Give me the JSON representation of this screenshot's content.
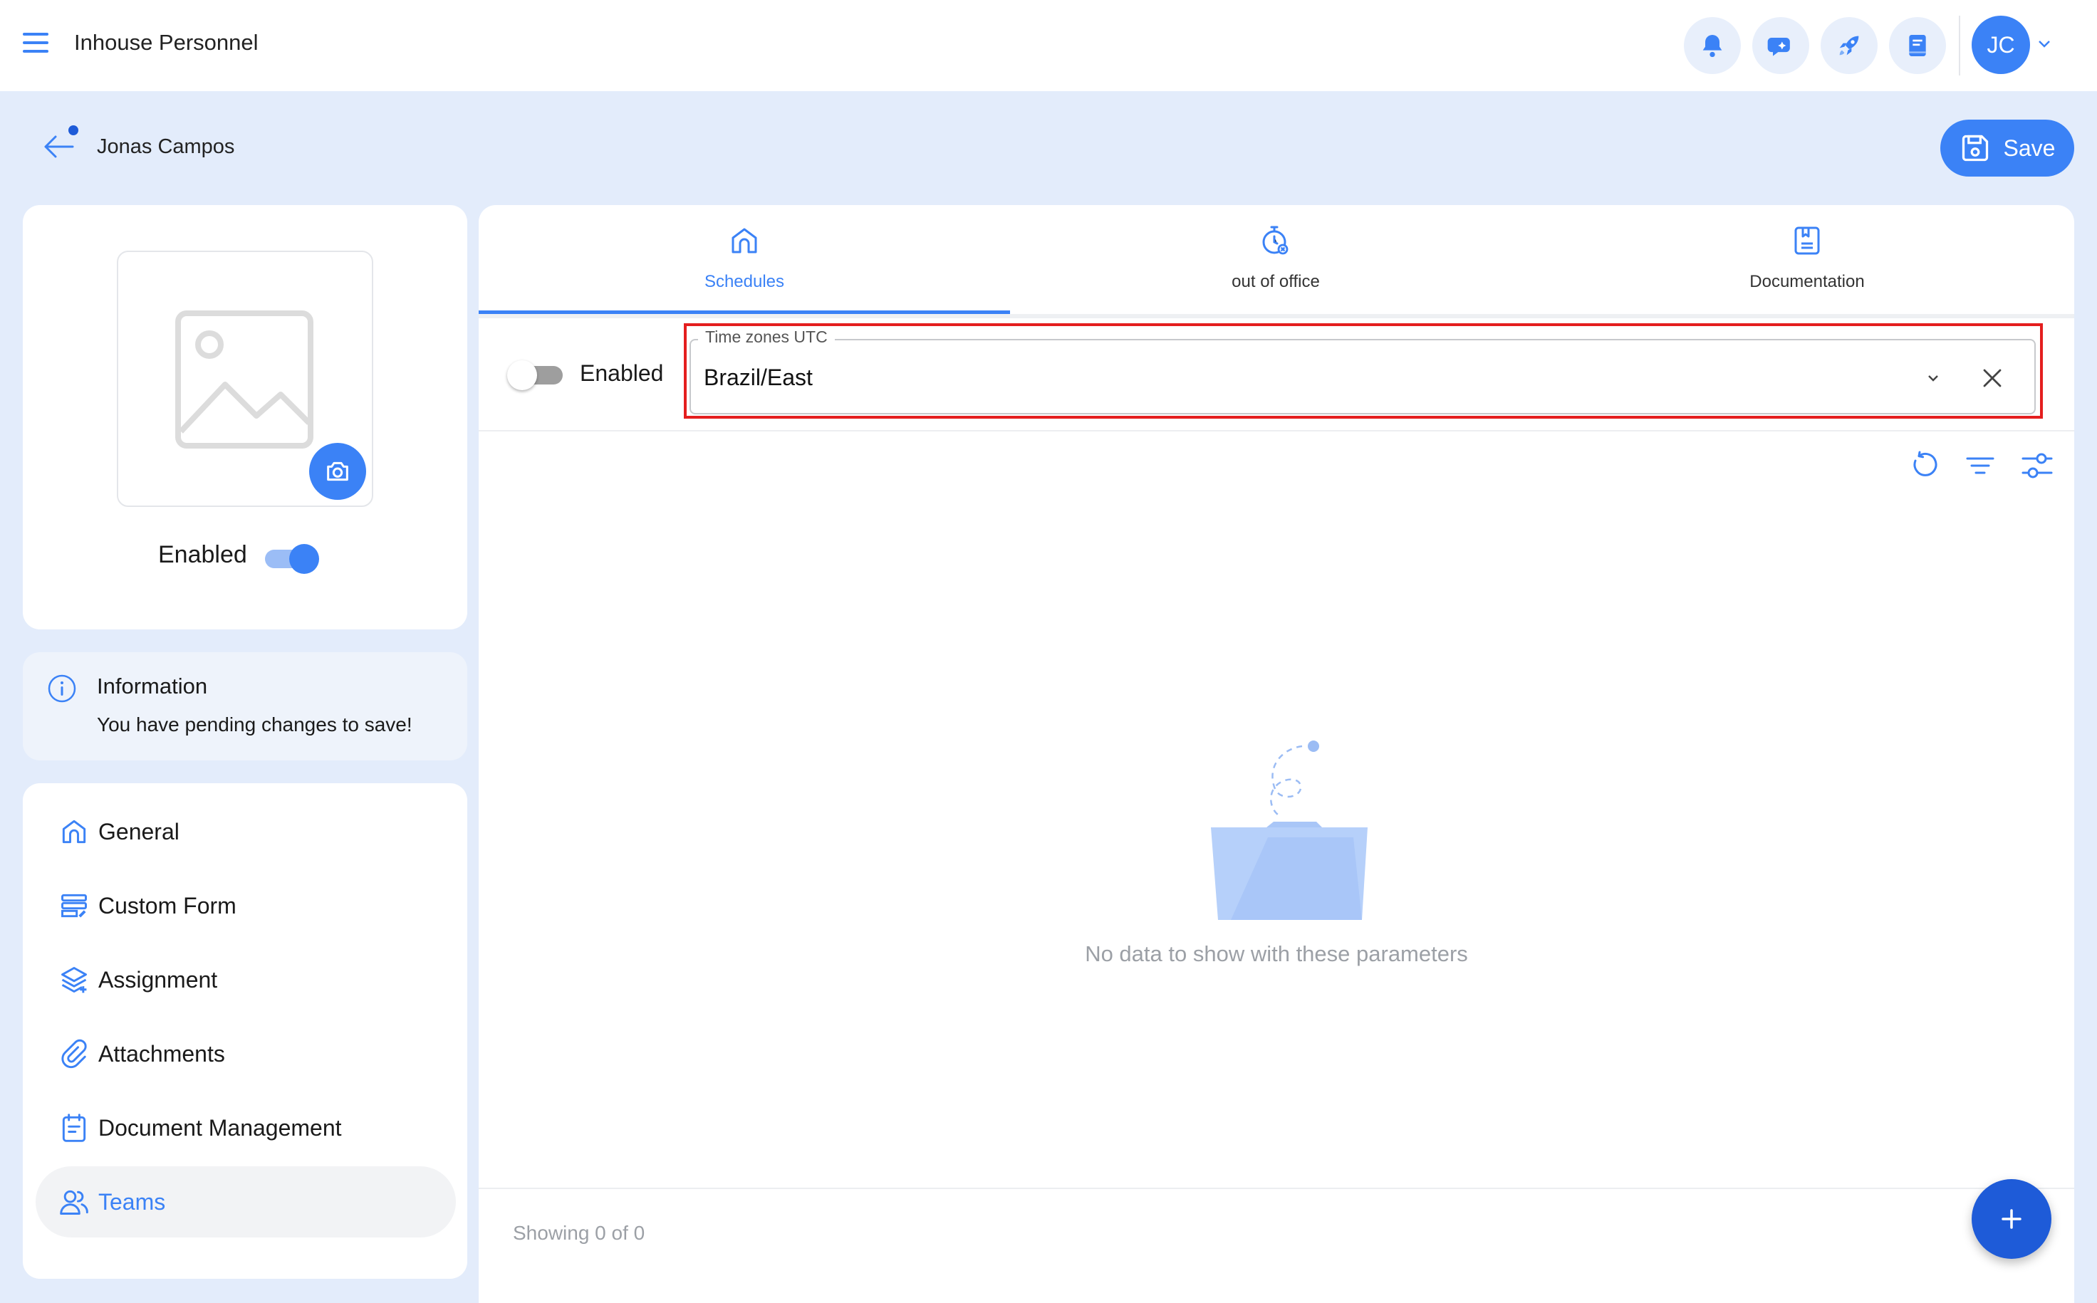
{
  "app": {
    "title": "Inhouse Personnel"
  },
  "topbar": {
    "icons": [
      "bell-icon",
      "chat-icon",
      "rocket-icon",
      "book-icon"
    ],
    "user_initials": "JC"
  },
  "header": {
    "person_name": "Jonas Campos",
    "save_label": "Save"
  },
  "profile": {
    "enabled_label": "Enabled",
    "enabled": true
  },
  "info": {
    "title": "Information",
    "text": "You have pending changes to save!"
  },
  "nav": {
    "items": [
      {
        "label": "General",
        "icon": "home-icon"
      },
      {
        "label": "Custom Form",
        "icon": "form-icon"
      },
      {
        "label": "Assignment",
        "icon": "layers-icon"
      },
      {
        "label": "Attachments",
        "icon": "paperclip-icon"
      },
      {
        "label": "Document Management",
        "icon": "calendar-doc-icon"
      },
      {
        "label": "Teams",
        "icon": "users-icon",
        "active": true
      }
    ]
  },
  "tabs": [
    {
      "label": "Schedules",
      "icon": "home-icon",
      "active": true
    },
    {
      "label": "out of office",
      "icon": "timer-icon"
    },
    {
      "label": "Documentation",
      "icon": "document-icon"
    }
  ],
  "filter": {
    "enabled_label": "Enabled",
    "enabled": false,
    "timezone_label": "Time zones UTC",
    "timezone_value": "Brazil/East"
  },
  "toolbar": {
    "icons": [
      "refresh-icon",
      "filter-icon",
      "adjust-icon"
    ]
  },
  "empty": {
    "message": "No data to show with these parameters"
  },
  "footer": {
    "showing": "Showing 0 of 0"
  },
  "colors": {
    "accent": "#3b82f6",
    "accent_dark": "#1e5bd8",
    "page_bg": "#e3ecfb",
    "highlight": "#e41e1e"
  }
}
